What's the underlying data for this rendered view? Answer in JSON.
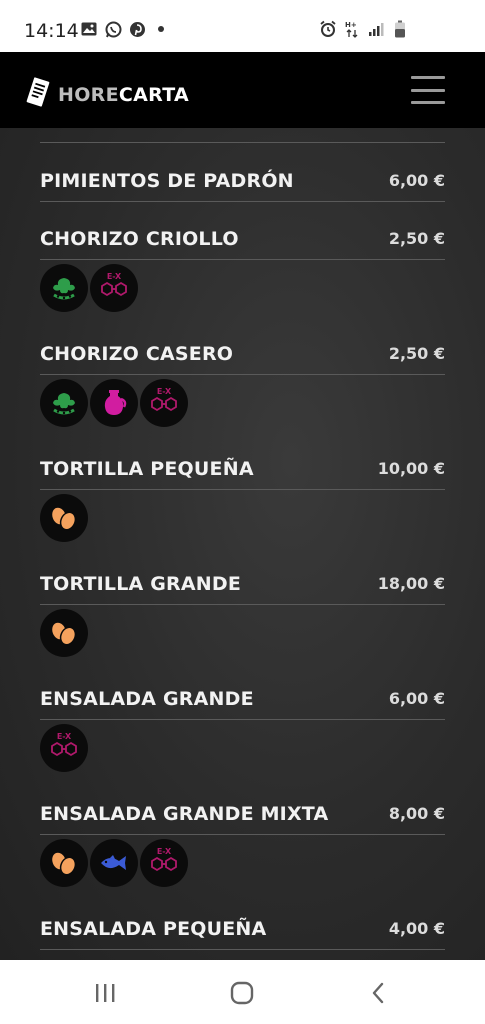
{
  "status_bar": {
    "time": "14:14",
    "left_icons": [
      "image-icon",
      "whatsapp-icon",
      "pinterest-icon",
      "dot-icon"
    ],
    "right_icons": [
      "alarm-icon",
      "data-arrows-icon",
      "signal-icon",
      "battery-icon"
    ]
  },
  "app_bar": {
    "logo_part1": "HORE",
    "logo_part2": "CARTA",
    "menu_icon": "hamburger-icon"
  },
  "colors": {
    "app_bar_bg": "#000000",
    "content_bg": "#2b2b2b",
    "allergen_green": "#2e9d4a",
    "allergen_magenta": "#b0196b",
    "allergen_orange": "#f5a25d",
    "allergen_blue": "#3b5bd6"
  },
  "menu_items": [
    {
      "name": "PIMIENTOS DE PADRÓN",
      "price": "6,00 €",
      "allergens": []
    },
    {
      "name": "CHORIZO CRIOLLO",
      "price": "2,50 €",
      "allergens": [
        "soy",
        "sulphites"
      ]
    },
    {
      "name": "CHORIZO CASERO",
      "price": "2,50 €",
      "allergens": [
        "soy",
        "milk",
        "sulphites"
      ]
    },
    {
      "name": "TORTILLA PEQUEÑA",
      "price": "10,00 €",
      "allergens": [
        "egg"
      ]
    },
    {
      "name": "TORTILLA GRANDE",
      "price": "18,00 €",
      "allergens": [
        "egg"
      ]
    },
    {
      "name": "ENSALADA GRANDE",
      "price": "6,00 €",
      "allergens": [
        "sulphites"
      ]
    },
    {
      "name": "ENSALADA GRANDE MIXTA",
      "price": "8,00 €",
      "allergens": [
        "egg",
        "fish",
        "sulphites"
      ]
    },
    {
      "name": "ENSALADA PEQUEÑA",
      "price": "4,00 €",
      "allergens": []
    }
  ],
  "allergen_labels": {
    "sulphites": "E-X"
  },
  "nav_bar": {
    "recents_icon": "recents-icon",
    "home_icon": "home-icon",
    "back_icon": "back-icon"
  }
}
